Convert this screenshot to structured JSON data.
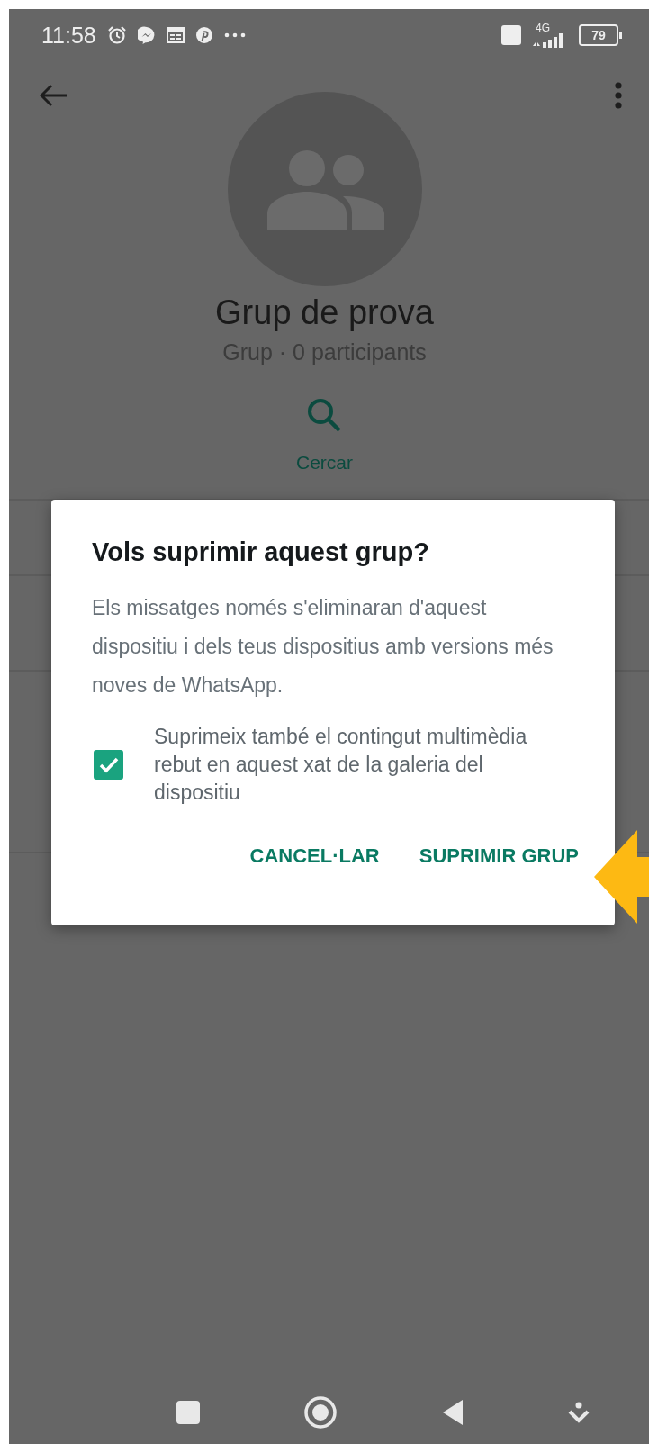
{
  "status_bar": {
    "time": "11:58",
    "network": "4G",
    "battery": "79"
  },
  "group": {
    "name": "Grup de prova",
    "subtitle": "Grup · 0 participants"
  },
  "actions": [
    {
      "label": "Cercar"
    }
  ],
  "dialog": {
    "title": "Vols suprimir aquest grup?",
    "message": "Els missatges només s'eliminaran d'aquest dispositiu i dels teus dispositius amb versions més noves de WhatsApp.",
    "checkbox": {
      "label": "Suprimeix també el contingut multimèdia rebut en aquest xat de la galeria del dispositiu",
      "checked": true
    },
    "buttons": [
      {
        "label": "CANCEL·LAR"
      },
      {
        "label": "SUPRIMIR GRUP"
      }
    ]
  }
}
